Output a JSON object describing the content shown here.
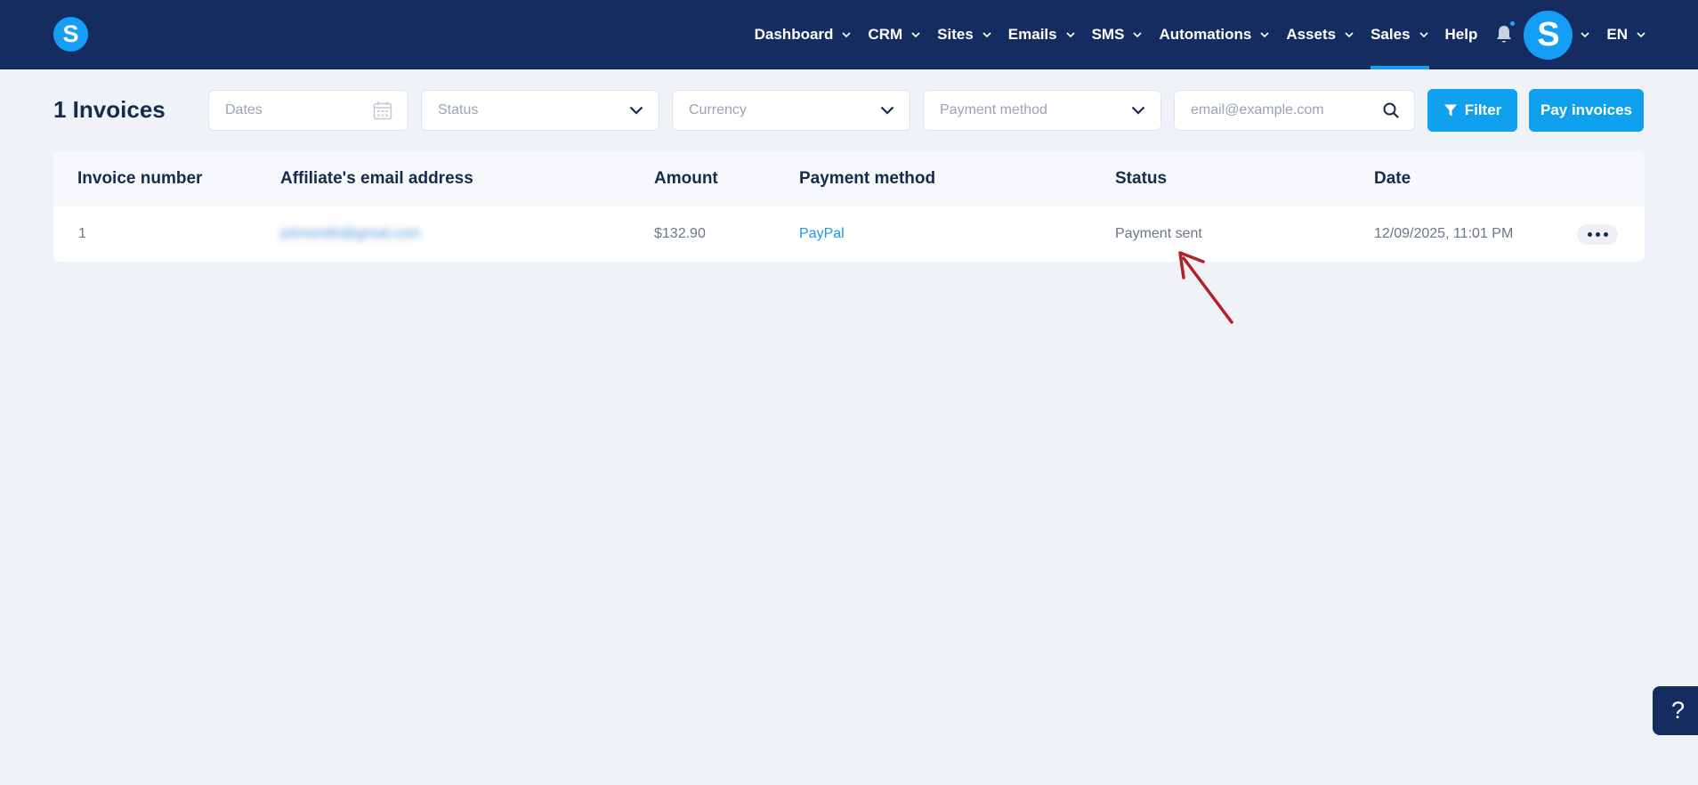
{
  "brand": {
    "logo_letter": "S",
    "nav_bg": "#152c61",
    "accent": "#0fa0ef"
  },
  "nav": {
    "items": [
      {
        "label": "Dashboard",
        "dropdown": true,
        "active": false
      },
      {
        "label": "CRM",
        "dropdown": true,
        "active": false
      },
      {
        "label": "Sites",
        "dropdown": true,
        "active": false
      },
      {
        "label": "Emails",
        "dropdown": true,
        "active": false
      },
      {
        "label": "SMS",
        "dropdown": true,
        "active": false
      },
      {
        "label": "Automations",
        "dropdown": true,
        "active": false
      },
      {
        "label": "Assets",
        "dropdown": true,
        "active": false
      },
      {
        "label": "Sales",
        "dropdown": true,
        "active": true
      },
      {
        "label": "Help",
        "dropdown": false,
        "active": false
      }
    ],
    "notification_icon": "bell-icon",
    "avatar_letter": "S",
    "language": "EN"
  },
  "page": {
    "title": "1 Invoices"
  },
  "filters": {
    "dates_placeholder": "Dates",
    "status_placeholder": "Status",
    "currency_placeholder": "Currency",
    "payment_method_placeholder": "Payment method",
    "search_placeholder": "email@example.com",
    "filter_label": "Filter",
    "pay_invoices_label": "Pay invoices"
  },
  "table": {
    "columns": [
      "Invoice number",
      "Affiliate's email address",
      "Amount",
      "Payment method",
      "Status",
      "Date"
    ],
    "rows": [
      {
        "invoice_number": "1",
        "email": "johnsmith@gmail.com",
        "amount": "$132.90",
        "payment_method": "PayPal",
        "status": "Payment sent",
        "date": "12/09/2025, 11:01 PM"
      }
    ]
  },
  "help": {
    "label": "?"
  }
}
